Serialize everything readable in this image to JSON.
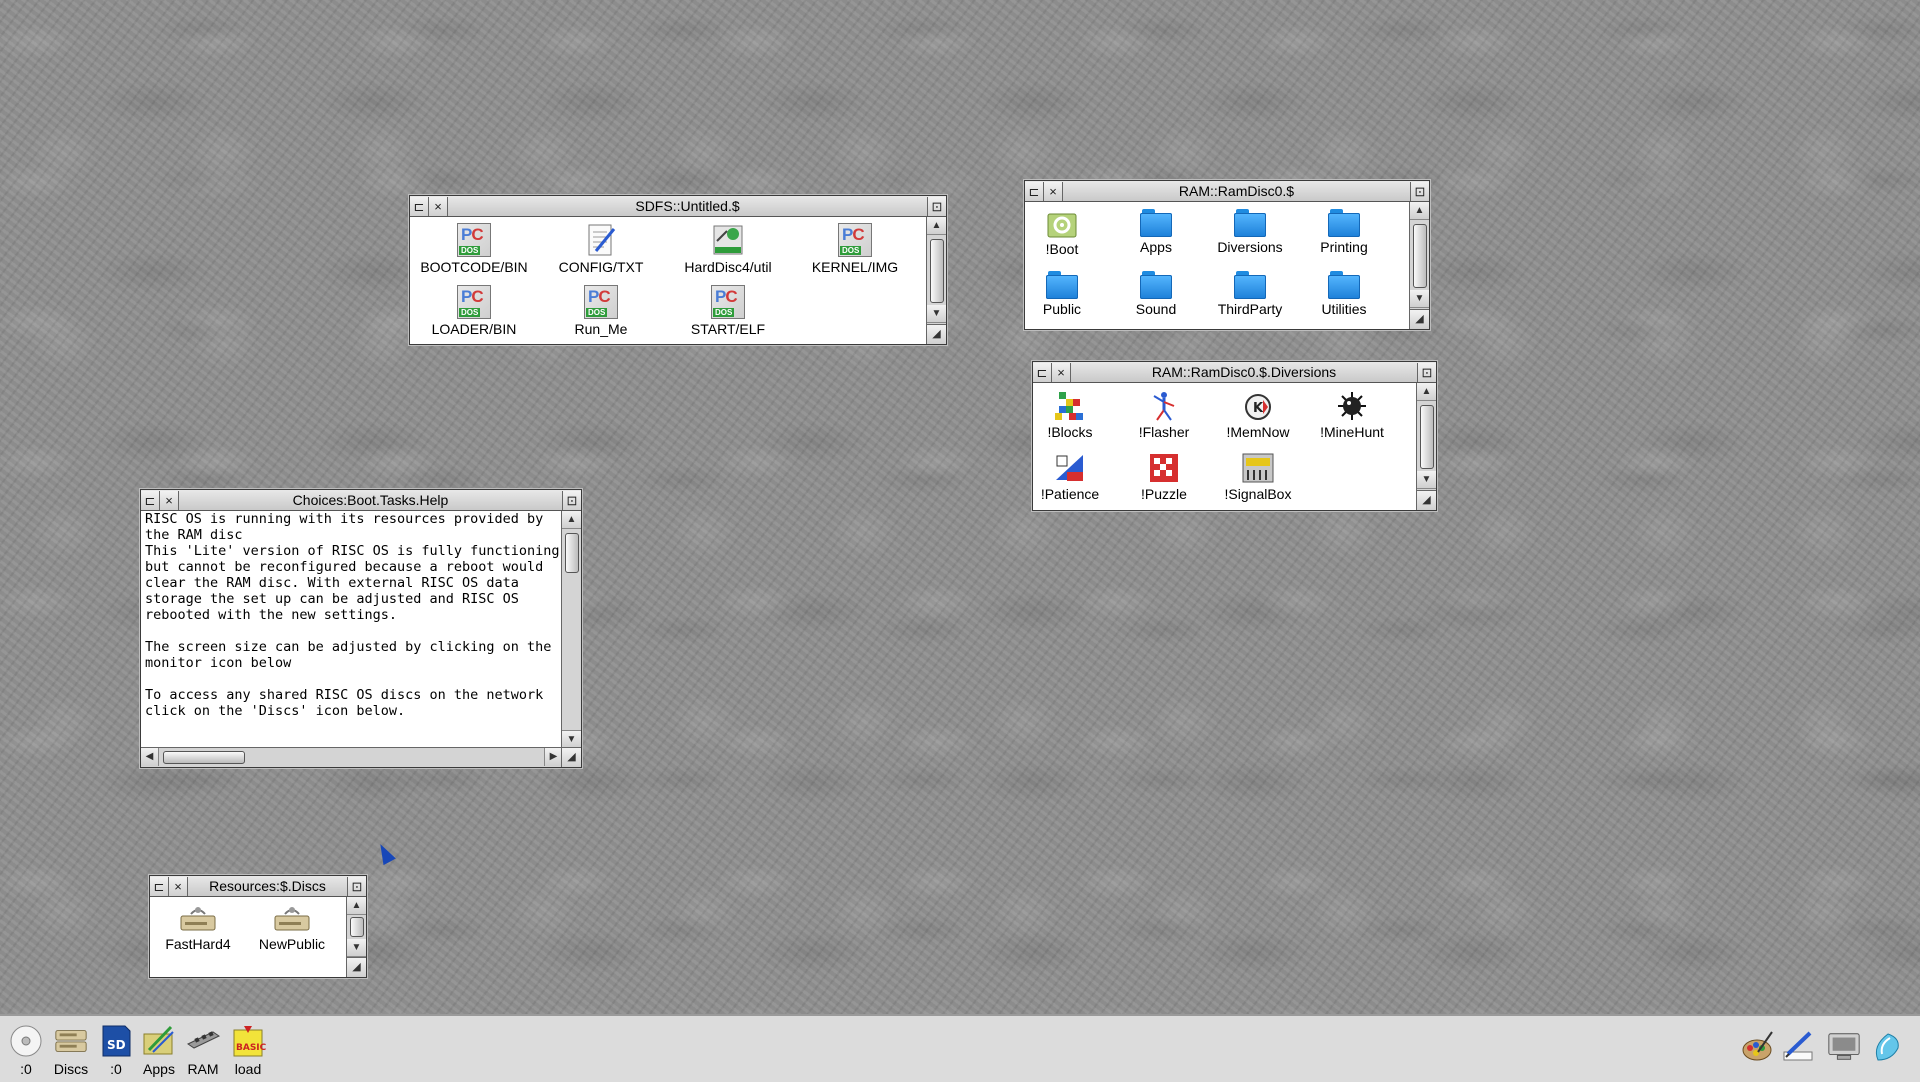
{
  "windows": {
    "sdfs": {
      "title": "SDFS::Untitled.$",
      "items": [
        {
          "label": "BOOTCODE/BIN",
          "icon": "pc-dos-file-icon"
        },
        {
          "label": "CONFIG/TXT",
          "icon": "text-file-icon"
        },
        {
          "label": "HardDisc4/util",
          "icon": "utility-file-icon"
        },
        {
          "label": "KERNEL/IMG",
          "icon": "pc-dos-file-icon"
        },
        {
          "label": "LOADER/BIN",
          "icon": "pc-dos-file-icon"
        },
        {
          "label": "Run_Me",
          "icon": "pc-dos-file-icon"
        },
        {
          "label": "START/ELF",
          "icon": "pc-dos-file-icon"
        }
      ]
    },
    "ramdisc": {
      "title": "RAM::RamDisc0.$",
      "items": [
        {
          "label": "!Boot",
          "icon": "boot-app-icon"
        },
        {
          "label": "Apps",
          "icon": "folder-icon"
        },
        {
          "label": "Diversions",
          "icon": "folder-open-icon"
        },
        {
          "label": "Printing",
          "icon": "folder-icon"
        },
        {
          "label": "Public",
          "icon": "folder-icon"
        },
        {
          "label": "Sound",
          "icon": "folder-icon"
        },
        {
          "label": "ThirdParty",
          "icon": "folder-icon"
        },
        {
          "label": "Utilities",
          "icon": "folder-icon"
        }
      ]
    },
    "diversions": {
      "title": "RAM::RamDisc0.$.Diversions",
      "items": [
        {
          "label": "!Blocks",
          "icon": "blocks-app-icon"
        },
        {
          "label": "!Flasher",
          "icon": "flasher-app-icon"
        },
        {
          "label": "!MemNow",
          "icon": "memnow-app-icon"
        },
        {
          "label": "!MineHunt",
          "icon": "mine-app-icon"
        },
        {
          "label": "!Patience",
          "icon": "patience-app-icon"
        },
        {
          "label": "!Puzzle",
          "icon": "puzzle-app-icon"
        },
        {
          "label": "!SignalBox",
          "icon": "signalbox-app-icon"
        }
      ]
    },
    "help": {
      "title": "Choices:Boot.Tasks.Help",
      "text": "RISC OS is running with its resources provided by\nthe RAM disc\nThis 'Lite' version of RISC OS is fully functioning\nbut cannot be reconfigured because a reboot would\nclear the RAM disc. With external RISC OS data\nstorage the set up can be adjusted and RISC OS\nrebooted with the new settings.\n\nThe screen size can be adjusted by clicking on the\nmonitor icon below\n\nTo access any shared RISC OS discs on the network\nclick on the 'Discs' icon below."
    },
    "discs": {
      "title": "Resources:$.Discs",
      "items": [
        {
          "label": "FastHard4",
          "icon": "hard-disc-icon"
        },
        {
          "label": "NewPublic",
          "icon": "hard-disc-icon"
        }
      ]
    }
  },
  "iconbar": {
    "left": [
      {
        "label": ":0",
        "icon": "cd-drive-icon"
      },
      {
        "label": "Discs",
        "icon": "network-discs-icon"
      },
      {
        "label": ":0",
        "icon": "sd-card-icon"
      },
      {
        "label": "Apps",
        "icon": "apps-icon"
      },
      {
        "label": "RAM",
        "icon": "ram-disc-icon"
      },
      {
        "label": "load",
        "icon": "basic-load-icon"
      }
    ],
    "right": [
      {
        "icon": "paint-palette-icon"
      },
      {
        "icon": "edit-pen-icon"
      },
      {
        "icon": "monitor-icon"
      },
      {
        "icon": "task-manager-icon"
      }
    ]
  },
  "colors": {
    "desktop": "#8e8e8e",
    "window_bg": "#ffffff",
    "titlebar": "#d0d0d0",
    "folder": "#2f95ef",
    "cursor": "#1747b8"
  }
}
